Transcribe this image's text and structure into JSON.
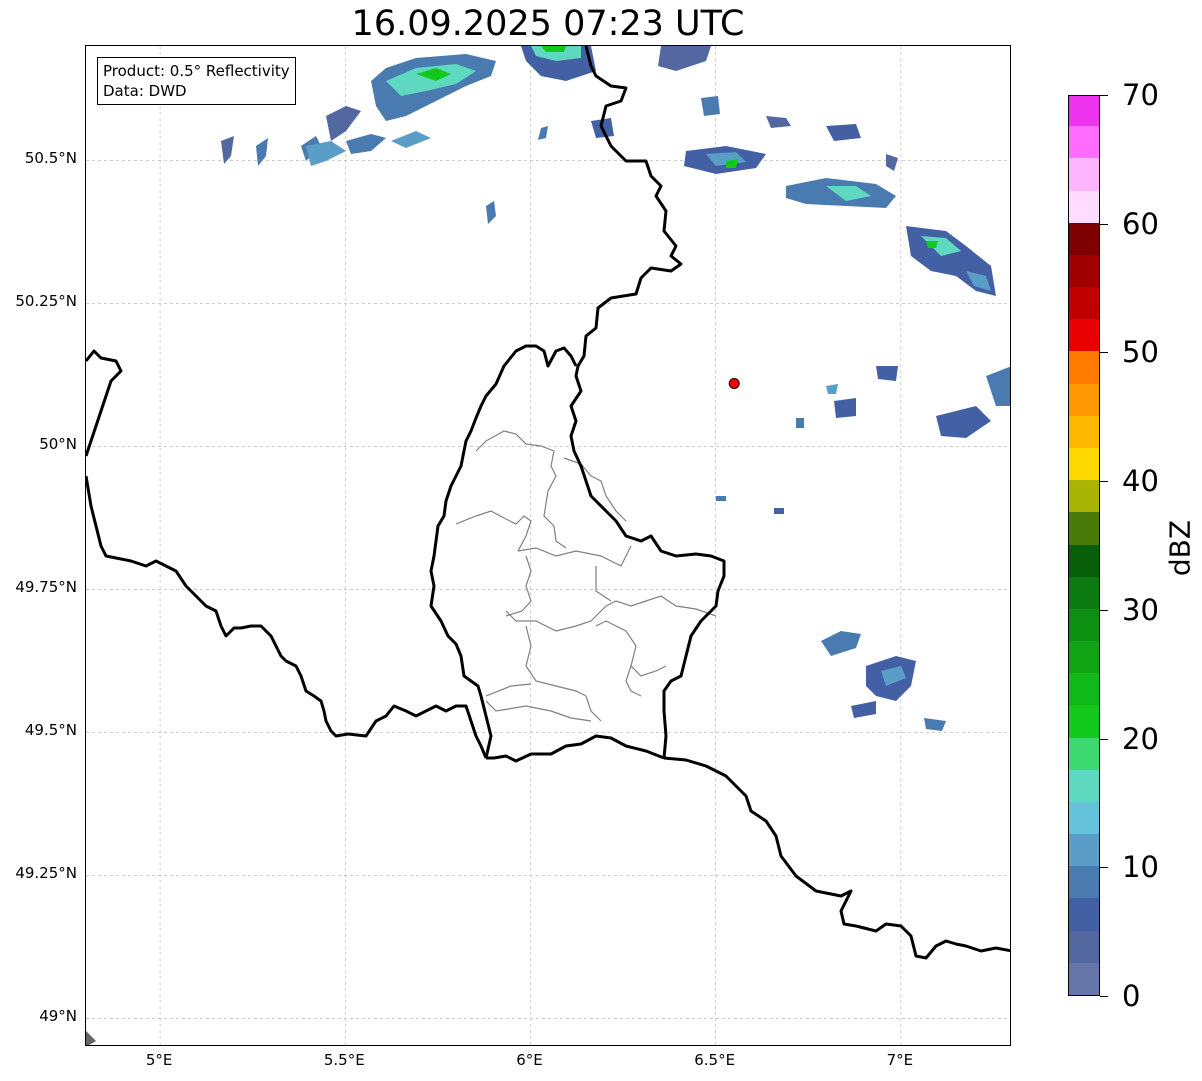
{
  "title": "16.09.2025 07:23 UTC",
  "info": {
    "product": "Product: 0.5° Reflectivity",
    "data": "Data: DWD"
  },
  "axes": {
    "lat_labels": [
      "50.5°N",
      "50.25°N",
      "50°N",
      "49.75°N",
      "49.5°N",
      "49.25°N",
      "49°N"
    ],
    "lat_values": [
      50.5,
      50.25,
      50.0,
      49.75,
      49.5,
      49.25,
      49.0
    ],
    "lon_labels": [
      "5°E",
      "5.5°E",
      "6°E",
      "6.5°E",
      "7°E"
    ],
    "lon_values": [
      5.0,
      5.5,
      6.0,
      6.5,
      7.0
    ],
    "extent": {
      "lon_min": 4.8,
      "lon_max": 7.3,
      "lat_min": 48.95,
      "lat_max": 50.7
    }
  },
  "radar_site": {
    "lon": 6.55,
    "lat": 50.11,
    "color": "#ff0000"
  },
  "colorbar": {
    "unit": "dBZ",
    "min": 0,
    "max": 70,
    "tick_labels": [
      "0",
      "10",
      "20",
      "30",
      "40",
      "50",
      "60",
      "70"
    ],
    "tick_values": [
      0,
      10,
      20,
      30,
      40,
      50,
      60,
      70
    ],
    "colors": [
      "#6675a8",
      "#5367a0",
      "#4460a5",
      "#4a7bb0",
      "#5a9dc6",
      "#66c1da",
      "#5fd8c0",
      "#3ed870",
      "#12c81a",
      "#10b818",
      "#10a314",
      "#0d8f12",
      "#0b7a10",
      "#075f0a",
      "#4a7a0a",
      "#aab405",
      "#ffd800",
      "#ffb800",
      "#ff9800",
      "#ff7a00",
      "#e80000",
      "#c00000",
      "#a00000",
      "#7e0000",
      "#ffdcff",
      "#ffb4ff",
      "#ff6cff",
      "#ee33ee"
    ]
  },
  "colors": {
    "border": "#000000",
    "canton": "#808080",
    "grid": "#b0b0b0"
  }
}
